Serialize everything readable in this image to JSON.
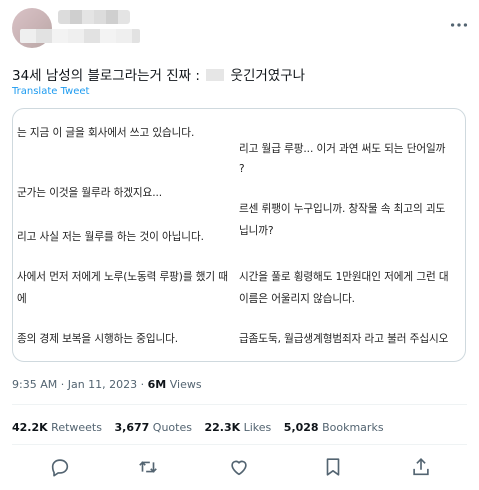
{
  "tweet": {
    "text_before": "34세 남성의 블로그라는거 진짜 :",
    "text_after": "웃긴거였구나",
    "translate_label": "Translate Tweet",
    "image_lines_left": [
      "는 지금 이 글을 회사에서 쓰고 있습니다.",
      "군가는 이것을 월루라 하겠지요...",
      "리고 사실 저는 월루를 하는 것이 아닙니다.",
      "사에서 먼저 저에게 노루(노동력 루팡)를 했기 때",
      "에",
      "종의 경제 보복을 시행하는 중입니다."
    ],
    "image_lines_right": [
      "리고 월급 루팡... 이거 과연 써도 되는 단어일까",
      "?",
      "르센 뤼팽이 누구입니까. 창작물 속 최고의 괴도",
      "닙니까?",
      "시간을 풀로 횡령해도 1만원대인 저에게 그런 대",
      "이름은 어울리지 않습니다.",
      "급좀도둑, 월급생계형범죄자 라고 불러 주십시오"
    ],
    "time": "9:35 AM",
    "date": "Jan 11, 2023",
    "views_count": "6M",
    "views_label": "Views",
    "stats": {
      "retweets_count": "42.2K",
      "retweets_label": "Retweets",
      "quotes_count": "3,677",
      "quotes_label": "Quotes",
      "likes_count": "22.3K",
      "likes_label": "Likes",
      "bookmarks_count": "5,028",
      "bookmarks_label": "Bookmarks"
    }
  },
  "icons": {
    "more": "more-horizontal-icon",
    "reply": "reply-icon",
    "retweet": "retweet-icon",
    "like": "heart-icon",
    "bookmark": "bookmark-icon",
    "share": "share-icon"
  },
  "colors": {
    "link": "#1d9bf0",
    "secondary_text": "#536471",
    "border": "#cfd9de"
  }
}
